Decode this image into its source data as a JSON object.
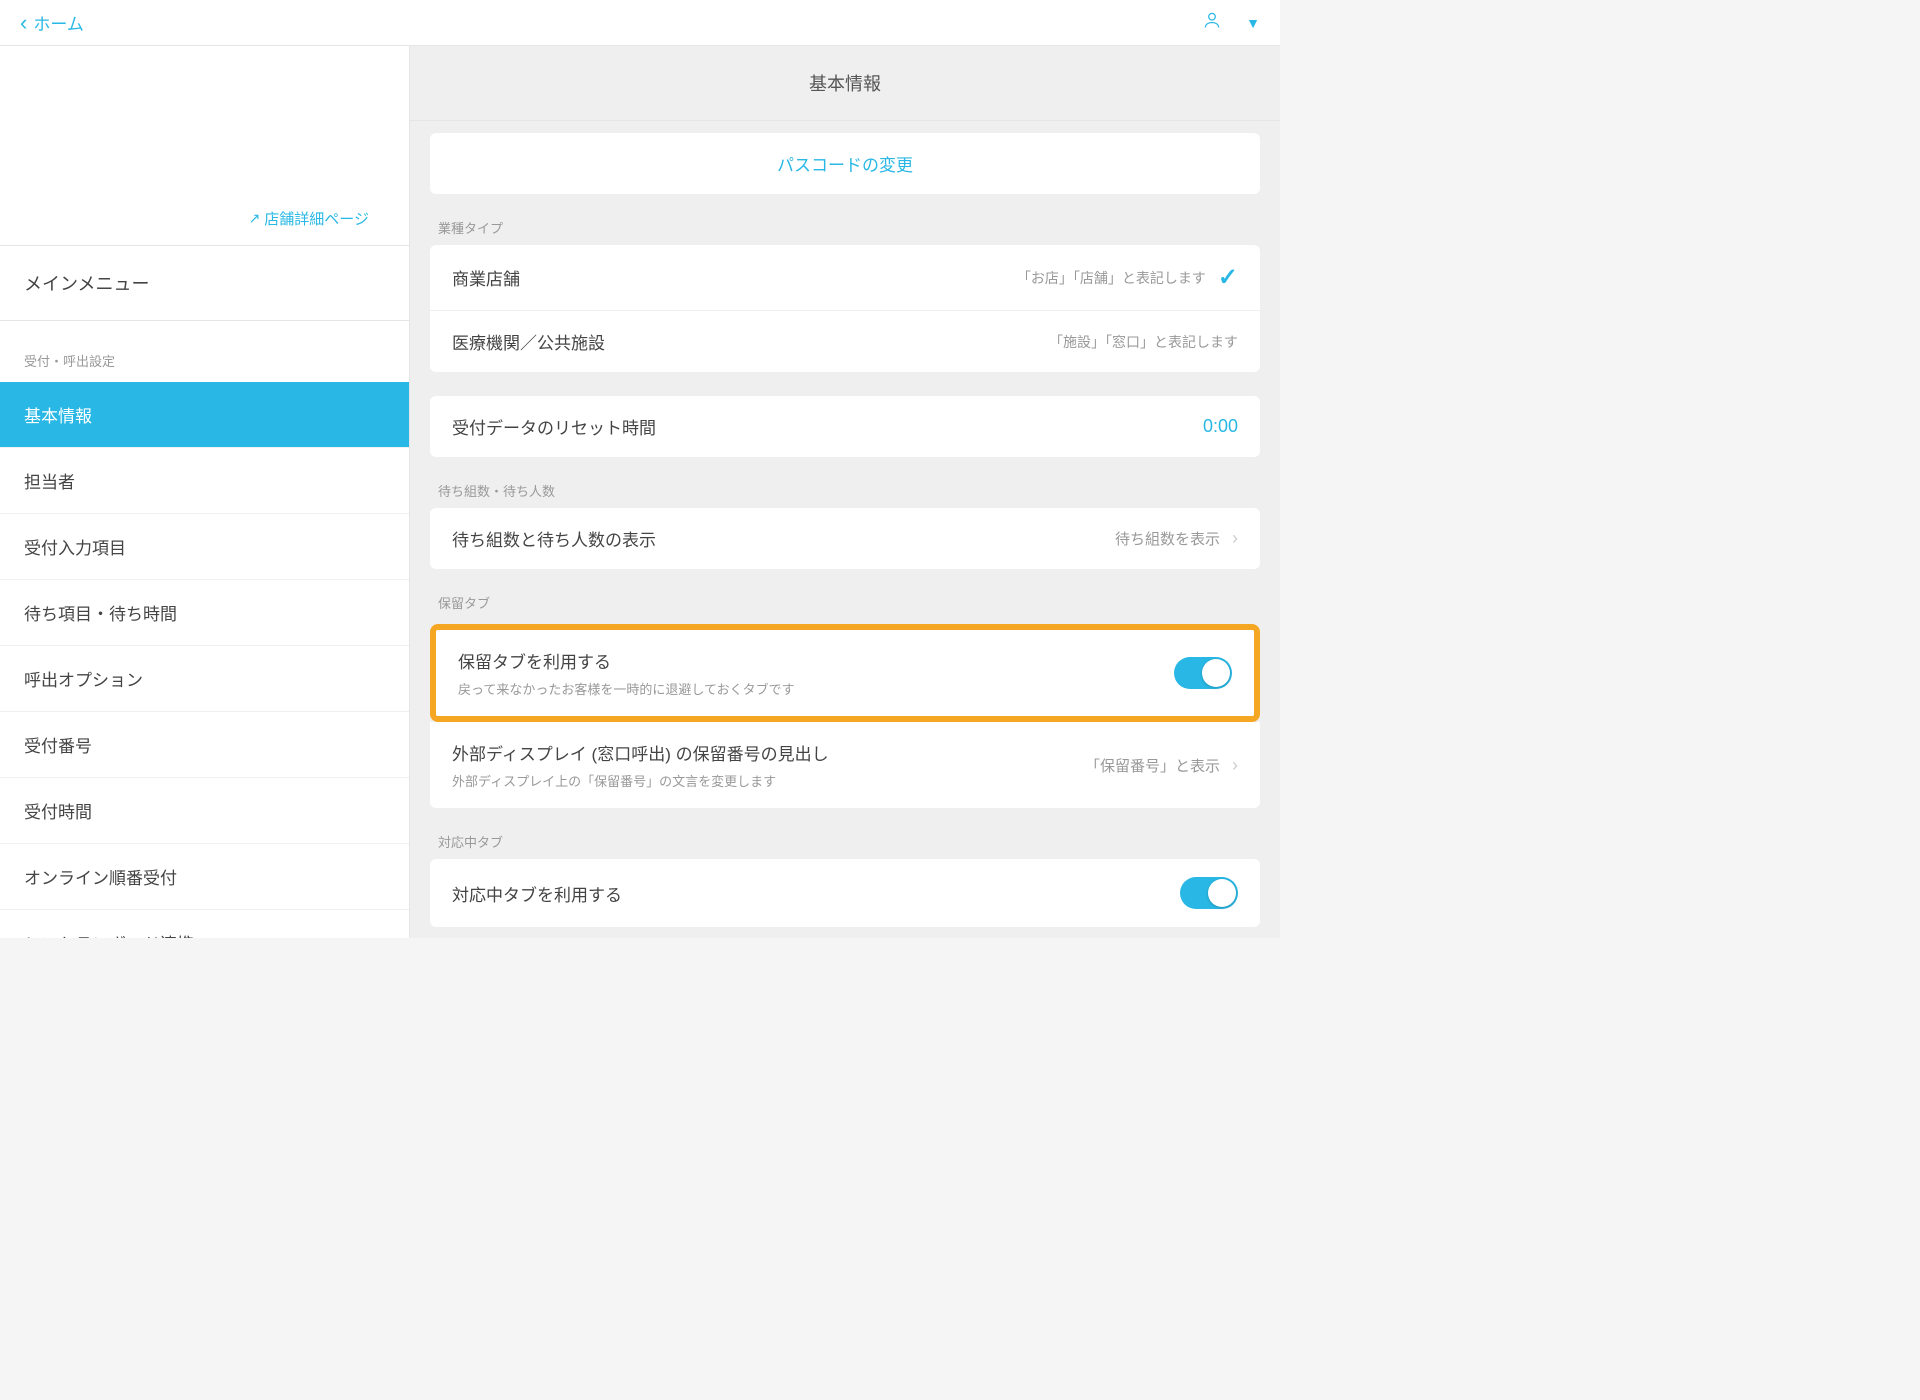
{
  "header": {
    "back_label": "ホーム"
  },
  "sidebar": {
    "store_link": "店舗詳細ページ",
    "main_menu": "メインメニュー",
    "section_label": "受付・呼出設定",
    "items": [
      "基本情報",
      "担当者",
      "受付入力項目",
      "待ち項目・待ち時間",
      "呼出オプション",
      "受付番号",
      "受付時間",
      "オンライン順番受付",
      "レストランボード連携"
    ]
  },
  "main": {
    "title": "基本情報",
    "passcode_button": "パスコードの変更",
    "business_type": {
      "label": "業種タイプ",
      "opt1_title": "商業店舗",
      "opt1_note": "「お店」「店舗」と表記します",
      "opt2_title": "医療機関／公共施設",
      "opt2_note": "「施設」「窓口」と表記します"
    },
    "reset_time": {
      "title": "受付データのリセット時間",
      "value": "0:00"
    },
    "wait_count": {
      "label": "待ち組数・待ち人数",
      "title": "待ち組数と待ち人数の表示",
      "value": "待ち組数を表示"
    },
    "hold_tab": {
      "label": "保留タブ",
      "toggle_title": "保留タブを利用する",
      "toggle_desc": "戻って来なかったお客様を一時的に退避しておくタブです",
      "display_title": "外部ディスプレイ (窓口呼出) の保留番号の見出し",
      "display_desc": "外部ディスプレイ上の「保留番号」の文言を変更します",
      "display_value": "「保留番号」と表示"
    },
    "active_tab": {
      "label": "対応中タブ",
      "toggle_title": "対応中タブを利用する"
    }
  }
}
